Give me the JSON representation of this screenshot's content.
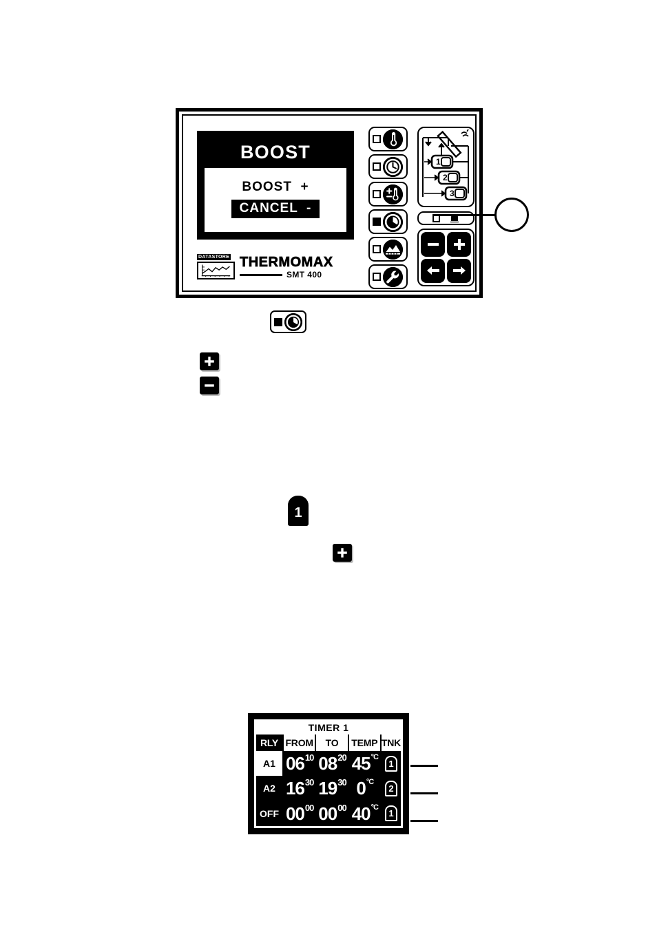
{
  "device": {
    "brand": "THERMOMAX",
    "model": "SMT 400",
    "datastore_label": "DATASTORE",
    "lcd": {
      "title": "BOOST",
      "options": [
        {
          "label": "BOOST  +",
          "selected": false
        },
        {
          "label": "CANCEL  -",
          "selected": true
        }
      ]
    },
    "function_buttons": [
      {
        "name": "temperature",
        "icon": "thermometer-icon",
        "led_on": false
      },
      {
        "name": "clock",
        "icon": "clock-icon",
        "led_on": false
      },
      {
        "name": "differential",
        "icon": "differential-icon",
        "led_on": false
      },
      {
        "name": "boost-timer",
        "icon": "boost-timer-icon",
        "led_on": true
      },
      {
        "name": "collector",
        "icon": "collector-icon",
        "led_on": false
      },
      {
        "name": "service",
        "icon": "wrench-icon",
        "led_on": false
      }
    ],
    "schematic": {
      "name": "solar-system-schematic",
      "tanks": [
        "1",
        "2",
        "3"
      ],
      "collector": "solar-collector-panel",
      "sun": "sun-icon"
    },
    "indicator_strip": {
      "items": [
        "display-indicator",
        "tank-indicator"
      ]
    },
    "keypad": [
      {
        "name": "minus-key",
        "glyph": "minus"
      },
      {
        "name": "plus-key",
        "glyph": "plus"
      },
      {
        "name": "left-arrow-key",
        "glyph": "left-arrow"
      },
      {
        "name": "right-arrow-key",
        "glyph": "right-arrow"
      }
    ]
  },
  "inline_icons": {
    "boost_button": {
      "icon": "boost-timer-icon",
      "led_on": true
    },
    "plus_key_1": {
      "glyph": "plus"
    },
    "minus_key_1": {
      "glyph": "minus"
    },
    "tank_tag": {
      "label": "1"
    },
    "plus_key_2": {
      "glyph": "plus"
    }
  },
  "timer_screen": {
    "title": "TIMER 1",
    "columns": [
      "RLY",
      "FROM",
      "TO",
      "TEMP",
      "TNK"
    ],
    "rows": [
      {
        "rly": "A1",
        "from_hour": "06",
        "from_min": "10",
        "to_hour": "08",
        "to_min": "20",
        "temp": "45",
        "temp_unit": "°C",
        "tnk": "1"
      },
      {
        "rly": "A2",
        "from_hour": "16",
        "from_min": "30",
        "to_hour": "19",
        "to_min": "30",
        "temp": "0",
        "temp_unit": "°C",
        "tnk": "2"
      },
      {
        "rly": "OFF",
        "from_hour": "00",
        "from_min": "00",
        "to_hour": "00",
        "to_min": "00",
        "temp": "40",
        "temp_unit": "°C",
        "tnk": "1"
      }
    ]
  },
  "colors": {
    "ink": "#000000",
    "paper": "#ffffff"
  }
}
